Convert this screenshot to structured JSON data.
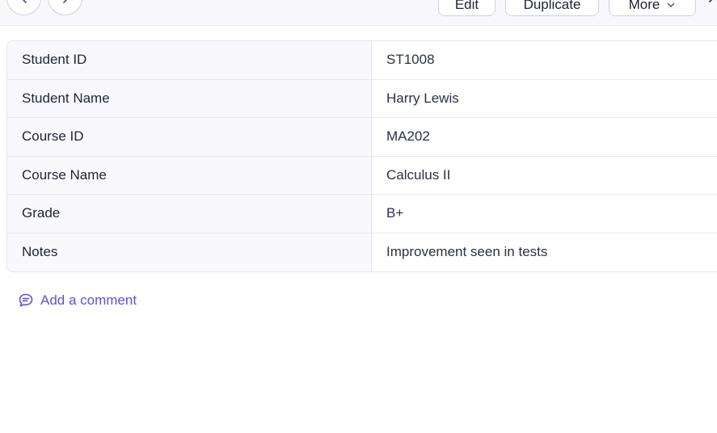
{
  "toolbar": {
    "prev_icon": "chevron-left-icon",
    "next_icon": "chevron-right-icon",
    "edit_label": "Edit",
    "duplicate_label": "Duplicate",
    "more_label": "More",
    "more_icon": "chevron-down-icon",
    "close_icon": "close-icon"
  },
  "record": {
    "fields": [
      {
        "label": "Student ID",
        "value": "ST1008"
      },
      {
        "label": "Student Name",
        "value": "Harry Lewis"
      },
      {
        "label": "Course ID",
        "value": "MA202"
      },
      {
        "label": "Course Name",
        "value": "Calculus II"
      },
      {
        "label": "Grade",
        "value": "B+"
      },
      {
        "label": "Notes",
        "value": "Improvement seen in tests"
      }
    ]
  },
  "comment": {
    "label": "Add a comment",
    "icon": "comment-icon"
  },
  "colors": {
    "accent": "#5a53d6",
    "label_bg": "#f9f9fd",
    "border": "#e3e4ec"
  }
}
